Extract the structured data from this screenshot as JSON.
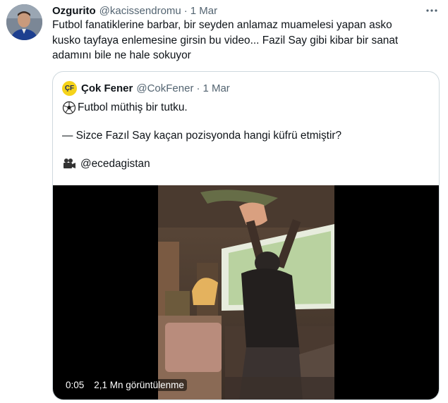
{
  "tweet": {
    "display_name": "Ozgurito",
    "handle": "@kacissendromu",
    "separator": "·",
    "date": "1 Mar",
    "more_icon": "more-horizontal-icon",
    "text_lines": [
      "Futbol fanatiklerine barbar, bir seyden anlamaz muamelesi yapan asko",
      "kusko tayfaya enlemesine girsin bu video... Fazil Say gibi kibar bir sanat",
      "adamını bile ne hale sokuyor"
    ]
  },
  "quote": {
    "logo_text": "ÇF",
    "display_name": "Çok Fener",
    "handle": "@CokFener",
    "separator": "·",
    "date": "1 Mar",
    "line1": "Futbol müthiş bir tutku.",
    "line2": "— Sizce Fazıl Say kaçan pozisyonda hangi küfrü etmiştir?",
    "line3": "@ecedagistan",
    "line1_icon": "soccer-ball-icon",
    "line3_icon": "movie-camera-icon"
  },
  "video": {
    "time": "0:05",
    "views": "2,1 Mn görüntülenme"
  },
  "colors": {
    "text": "#0f1419",
    "secondary": "#536471",
    "border": "#cfd9de",
    "fener_yellow": "#f5d31a",
    "fener_navy": "#1b2a5e"
  }
}
